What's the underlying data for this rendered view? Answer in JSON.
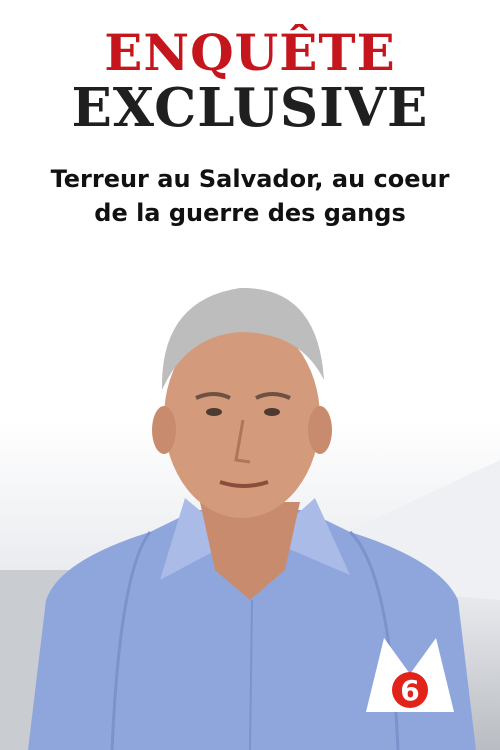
{
  "title": {
    "line1": "ENQUÊTE",
    "line2": "EXCLUSIVE"
  },
  "subtitle": {
    "line1": "Terreur au Salvador, au coeur",
    "line2": "de la guerre des gangs"
  },
  "channel_logo": {
    "letter": "M",
    "number": "6",
    "icon": "m6-logo"
  },
  "colors": {
    "title_accent": "#c4161c",
    "title_dark": "#1f1f1f",
    "shirt": "#8fa6dc",
    "logo_red": "#e2231a",
    "background": "#ffffff"
  }
}
